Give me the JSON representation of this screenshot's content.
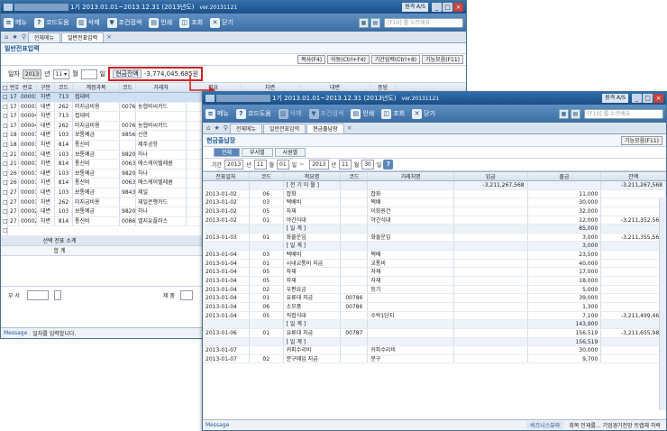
{
  "w1": {
    "title": "1기 2013.01.01~2013.12.31 (2013년도)",
    "version": "ver.20131121",
    "title_extra": "원격 A/S",
    "toolbar": [
      {
        "label": "메뉴",
        "icon": "menu-icon"
      },
      {
        "label": "코드도움",
        "icon": "help-icon"
      },
      {
        "label": "삭제",
        "icon": "trash-icon"
      },
      {
        "label": "조건검색",
        "icon": "filter-icon"
      },
      {
        "label": "인쇄",
        "icon": "printer-icon"
      },
      {
        "label": "조회",
        "icon": "view-icon"
      },
      {
        "label": "닫기",
        "icon": "close-icon"
      }
    ],
    "search_placeholder": "[F10] 를 누르세요",
    "tabs": [
      "전체메뉴",
      "일반전표입력"
    ],
    "subtitle": "일반전표입력",
    "actions": [
      "복사(F4)",
      "이동(Ctrl+F4)",
      "기간입력(Ctrl+8)",
      "기능모음(F11)"
    ],
    "form": {
      "date_label": "일자",
      "year": "2013",
      "year_unit": "년",
      "month": "11",
      "month_unit": "월",
      "day_unit": "일",
      "balance_label": "현금잔액",
      "balance": "-3,774,045,685원"
    },
    "columns": [
      "",
      "번호",
      "구분",
      "코드",
      "계정과목",
      "코드",
      "거래처",
      "적요",
      "차변",
      "대변",
      "증빙"
    ],
    "rows": [
      [
        "17",
        "00003",
        "차변",
        "713",
        "접대비",
        "",
        "",
        ""
      ],
      [
        "17",
        "00003",
        "대변",
        "262",
        "미지급비용",
        "00761",
        "농협비씨카드",
        ""
      ],
      [
        "17",
        "00004",
        "차변",
        "713",
        "접대비",
        "",
        "",
        ""
      ],
      [
        "17",
        "00004",
        "대변",
        "262",
        "미지급비용",
        "00761",
        "농협비씨카드",
        ""
      ],
      [
        "18",
        "00001",
        "대변",
        "103",
        "보통예금",
        "98561",
        "신한",
        ""
      ],
      [
        "18",
        "00001",
        "차변",
        "814",
        "통신비",
        "",
        "제주공항",
        ""
      ],
      [
        "21",
        "00001",
        "대변",
        "103",
        "보통예금",
        "98204",
        "하나",
        ""
      ],
      [
        "21",
        "00001",
        "차변",
        "814",
        "통신비",
        "00633",
        "에스케이텔레콤",
        ""
      ],
      [
        "26",
        "00001",
        "대변",
        "103",
        "보통예금",
        "98204",
        "하나",
        ""
      ],
      [
        "26",
        "00001",
        "차변",
        "814",
        "통신비",
        "00633",
        "에스케이텔레콤",
        ""
      ],
      [
        "27",
        "00001",
        "대변",
        "103",
        "보통예금",
        "98433",
        "제일",
        ""
      ],
      [
        "27",
        "00001",
        "차변",
        "262",
        "미지급비용",
        "",
        "재일은행카드",
        ""
      ],
      [
        "27",
        "00002",
        "대변",
        "103",
        "보통예금",
        "98204",
        "하나",
        ""
      ],
      [
        "27",
        "00002",
        "차변",
        "814",
        "통신비",
        "00860",
        "엘지유플러스",
        ""
      ]
    ],
    "sum_label": "선택 전표 소계",
    "total_label": "합 계",
    "side_label": "차액",
    "dept_label": "부 서",
    "title_label": "제 품",
    "message_label": "Message",
    "message": "일자를 입력합니다."
  },
  "w2": {
    "title": "1기 2013.01.01~2013.12.31 (2013년도)",
    "version": "ver.20131121",
    "title_extra": "원격 A/S",
    "toolbar": [
      {
        "label": "메뉴",
        "icon": "menu-icon"
      },
      {
        "label": "코드도움",
        "icon": "help-icon"
      },
      {
        "label": "삭제",
        "icon": "trash-icon"
      },
      {
        "label": "조건검색",
        "icon": "filter-icon"
      },
      {
        "label": "인쇄",
        "icon": "printer-icon"
      },
      {
        "label": "조회",
        "icon": "view-icon"
      },
      {
        "label": "닫기",
        "icon": "close-icon"
      }
    ],
    "search_placeholder": "[F10] 를 누르세요",
    "tabs": [
      "전체메뉴",
      "일반전표입력",
      "현금출납장"
    ],
    "subtitle": "현금출납장",
    "func_button": "기능모음(F11)",
    "subtabs": [
      "전체",
      "부서별",
      "사원별"
    ],
    "period": {
      "label": "기간",
      "y1": "2013",
      "m1": "11",
      "d1": "01",
      "y2": "2013",
      "m2": "11",
      "d2": "30",
      "ny": "년",
      "nm": "월",
      "nd": "일",
      "tilde": "~"
    },
    "columns": [
      "전표일자",
      "코드",
      "적요명",
      "코드",
      "거래처명",
      "입금",
      "출금",
      "잔액"
    ],
    "rows": [
      [
        "",
        "",
        "[ 전 기 이 월 ]",
        "",
        "",
        "-3,211,267,568",
        "",
        "-3,211,267,568",
        1
      ],
      [
        "2013-01-02",
        "06",
        "잡화",
        "",
        "잡화",
        "",
        "11,000",
        "",
        0
      ],
      [
        "2013-01-02",
        "03",
        "택배비",
        "",
        "택배",
        "",
        "30,000",
        "",
        0
      ],
      [
        "2013-01-02",
        "05",
        "자재",
        "",
        "이화원건",
        "",
        "32,000",
        "",
        0
      ],
      [
        "2013-01-02",
        "01",
        "야간식대",
        "",
        "야간식대",
        "",
        "12,000",
        "-3,211,352,568",
        0
      ],
      [
        "",
        "",
        "[ 일 계 ]",
        "",
        "",
        "",
        "85,000",
        "",
        1
      ],
      [
        "2013-01-03",
        "01",
        "화물운임",
        "",
        "화물운임",
        "",
        "3,000",
        "-3,211,355,568",
        0
      ],
      [
        "",
        "",
        "[ 일 계 ]",
        "",
        "",
        "",
        "3,000",
        "",
        1
      ],
      [
        "2013-01-04",
        "03",
        "택배비",
        "",
        "택배",
        "",
        "23,500",
        "",
        0
      ],
      [
        "2013-01-04",
        "01",
        "시내교통비 지급",
        "",
        "교통비",
        "",
        "40,000",
        "",
        0
      ],
      [
        "2013-01-04",
        "05",
        "자재",
        "",
        "자재",
        "",
        "17,000",
        "",
        0
      ],
      [
        "2013-01-04",
        "05",
        "자재",
        "",
        "자재",
        "",
        "18,000",
        "",
        0
      ],
      [
        "2013-01-04",
        "02",
        "우편요금",
        "",
        "등기",
        "",
        "5,000",
        "",
        0
      ],
      [
        "2013-01-04",
        "01",
        "유류대 지급",
        "00786",
        "",
        "",
        "39,000",
        "",
        0
      ],
      [
        "2013-01-04",
        "06",
        "소모품",
        "00786",
        "",
        "",
        "1,300",
        "",
        0
      ],
      [
        "2013-01-04",
        "05",
        "직접식대",
        "",
        "수락1단지",
        "",
        "7,100",
        "-3,211,499,468",
        0
      ],
      [
        "",
        "",
        "[ 일 계 ]",
        "",
        "",
        "",
        "143,900",
        "",
        1
      ],
      [
        "2013-01-06",
        "01",
        "유류대 지급",
        "00787",
        "",
        "",
        "156,519",
        "-3,211,655,987",
        0
      ],
      [
        "",
        "",
        "[ 일 계 ]",
        "",
        "",
        "",
        "156,519",
        "",
        1
      ],
      [
        "2013-01-07",
        "",
        "커피수리비",
        "",
        "커피수리비",
        "",
        "30,000",
        "",
        0
      ],
      [
        "2013-01-07",
        "02",
        "문구매입 지급",
        "",
        "문구",
        "",
        "9,700",
        "",
        0
      ]
    ],
    "message_label": "Message",
    "status_links": "비즈니스뷰와",
    "status_text": "회복 인재를... 기업경기전망 트랩체 하락"
  },
  "colors": {
    "accent": "#2f6fae",
    "highlight": "#d42020"
  }
}
